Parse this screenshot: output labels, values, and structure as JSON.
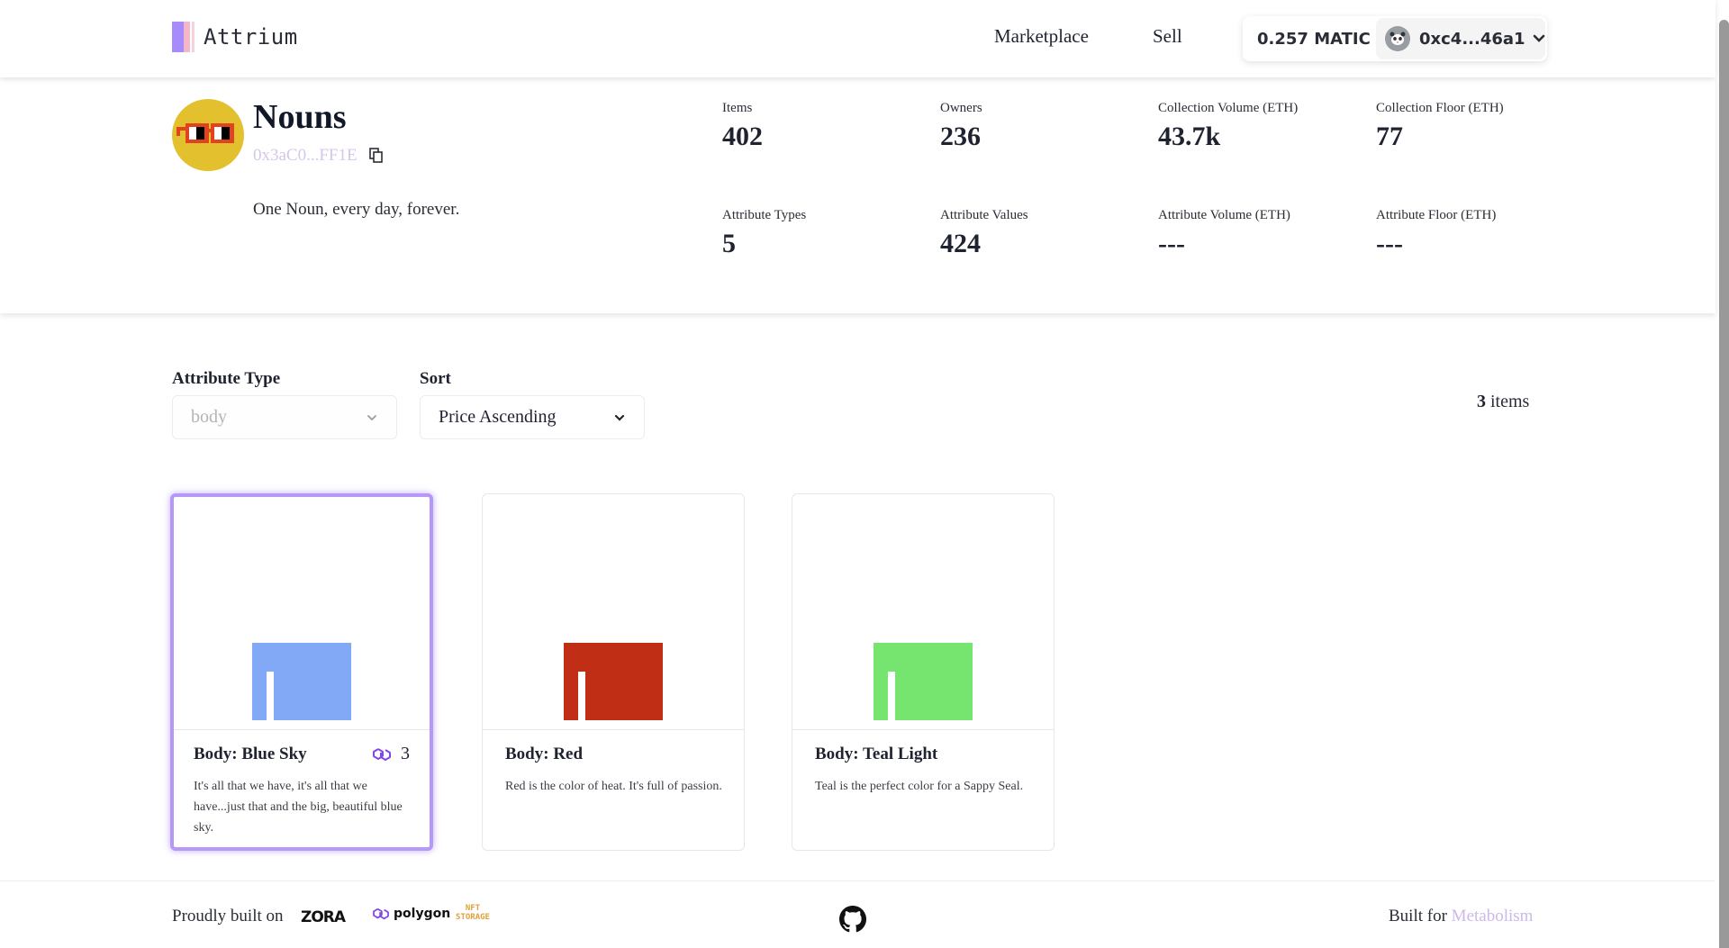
{
  "header": {
    "brand": "Attrium",
    "nav": [
      "Marketplace",
      "Sell"
    ],
    "wallet": {
      "balance": "0.257 MATIC",
      "address": "0xc4...46a1",
      "avatar_icon": "panda-avatar-icon"
    }
  },
  "collection": {
    "name": "Nouns",
    "address": "0x3aC0...FF1E",
    "description": "One Noun, every day, forever.",
    "avatar_colors": {
      "background": "#e3c12e",
      "glasses": "#e2431f"
    },
    "stats": [
      {
        "label": "Items",
        "value": "402"
      },
      {
        "label": "Owners",
        "value": "236"
      },
      {
        "label": "Collection Volume (ETH)",
        "value": "43.7k"
      },
      {
        "label": "Collection Floor (ETH)",
        "value": "77"
      },
      {
        "label": "Attribute Types",
        "value": "5"
      },
      {
        "label": "Attribute Values",
        "value": "424"
      },
      {
        "label": "Attribute Volume (ETH)",
        "value": "---"
      },
      {
        "label": "Attribute Floor (ETH)",
        "value": "---"
      }
    ]
  },
  "filters": {
    "attribute_type": {
      "label": "Attribute Type",
      "value": "body"
    },
    "sort": {
      "label": "Sort",
      "value": "Price Ascending"
    },
    "count": {
      "number": "3",
      "suffix": " items"
    }
  },
  "items": [
    {
      "title": "Body: Blue Sky",
      "price": "3",
      "price_icon": "polygon-icon",
      "description": "It's all that we have, it's all that we have...just that and the big, beautiful blue sky.",
      "color": "#81a9f5",
      "selected": true
    },
    {
      "title": "Body: Red",
      "price": "",
      "description": "Red is the color of heat. It's full of passion.",
      "color": "#c12e16",
      "selected": false
    },
    {
      "title": "Body: Teal Light",
      "price": "",
      "description": "Teal is the perfect color for a Sappy Seal.",
      "color": "#76e56f",
      "selected": false
    }
  ],
  "footer": {
    "built_on": "Proudly built on",
    "partners": [
      "ZORA",
      "polygon",
      "NFT STORAGE"
    ],
    "built_for": "Built for",
    "built_for_link": "Metabolism"
  },
  "colors": {
    "accent": "#a78bfa",
    "link": "#cdb9e8"
  }
}
